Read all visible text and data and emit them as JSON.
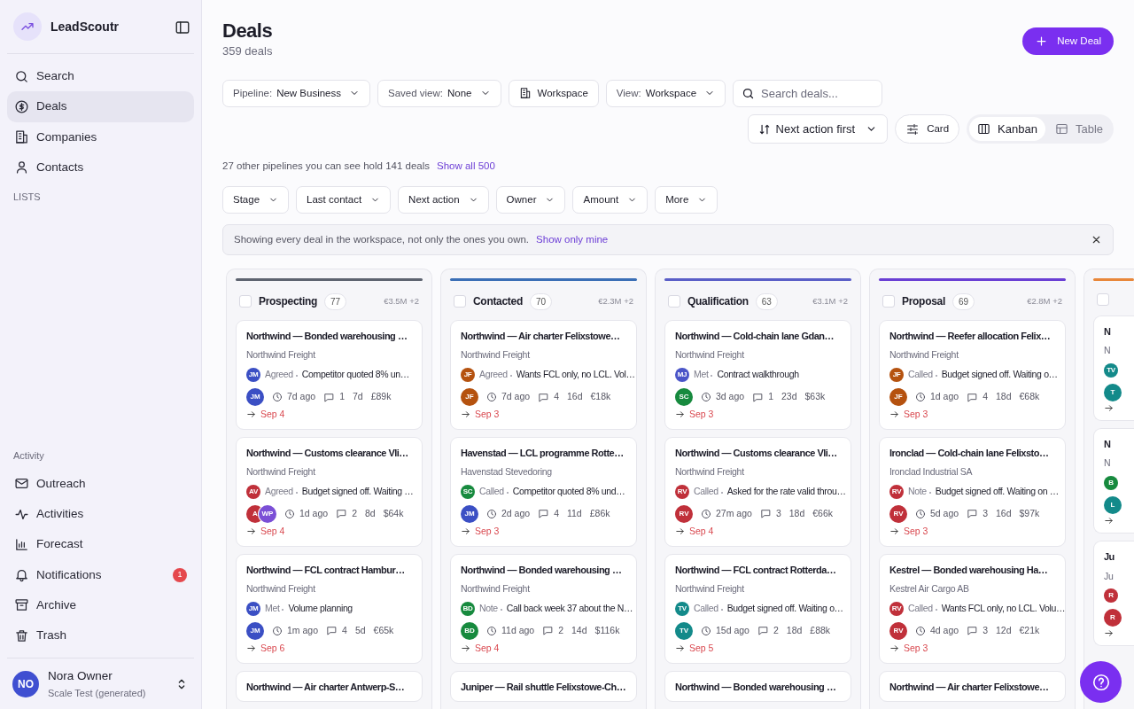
{
  "sidebar": {
    "brand": "LeadScoutr",
    "nav": [
      {
        "label": "Search",
        "selected": false
      },
      {
        "label": "Deals",
        "selected": true
      },
      {
        "label": "Companies",
        "selected": false
      },
      {
        "label": "Contacts",
        "selected": false
      }
    ],
    "lists_heading": "LISTS",
    "activity_heading": "Activity",
    "activity_nav": [
      {
        "label": "Outreach",
        "selected": false
      },
      {
        "label": "Activities",
        "selected": false
      },
      {
        "label": "Forecast",
        "selected": false
      },
      {
        "label": "Notifications",
        "selected": false,
        "badge": "1"
      },
      {
        "label": "Archive",
        "selected": false
      },
      {
        "label": "Trash",
        "selected": false
      }
    ],
    "user": {
      "initials": "NO",
      "color": "#3f4fd1",
      "name": "Nora Owner",
      "workspace": "Scale Test (generated)"
    }
  },
  "header": {
    "title": "Deals",
    "subtitle": "359 deals",
    "new_button": "New Deal"
  },
  "toolbar": {
    "filters": [
      {
        "kind": "dropdown",
        "label": "Pipeline:",
        "value": "New Business"
      },
      {
        "kind": "dropdown",
        "label": "Saved view:",
        "value": "None"
      },
      {
        "kind": "button",
        "value": "Workspace"
      },
      {
        "kind": "dropdown",
        "label": "View:",
        "value": "Workspace"
      }
    ],
    "search": {
      "placeholder": "Search deals..."
    },
    "sort": "Next action first",
    "density": "Card",
    "views": [
      {
        "label": "Kanban",
        "selected": true
      },
      {
        "label": "Table",
        "selected": false
      }
    ]
  },
  "pipelines_note": {
    "text": "27 other pipelines you can see hold 141 deals",
    "link": "Show all 500"
  },
  "chips": [
    "Stage",
    "Last contact",
    "Next action",
    "Owner",
    "Amount",
    "More"
  ],
  "banner": {
    "text": "Showing every deal in the workspace, not only the ones you own.",
    "link": "Show only mine"
  },
  "columns": [
    {
      "name": "Prospecting",
      "count": "77",
      "total": "€3.5M +2",
      "color": "#5e6470",
      "checked": false,
      "cards": [
        {
          "kind": "full",
          "title": "Northwind — Bonded warehousing …",
          "company": "Northwind Freight",
          "activity": {
            "initials": "JM",
            "color": "#3b4fc4",
            "label": "Agreed",
            "note": "Competitor quoted 8% un…"
          },
          "owners": [
            {
              "initials": "JM",
              "color": "#3b4fc4"
            }
          ],
          "last_contact": "7d ago",
          "comments": "1",
          "age": "7d",
          "amount": "£89k",
          "next": "Sep 4"
        },
        {
          "kind": "full",
          "title": "Northwind — Customs clearance Vli…",
          "company": "Northwind Freight",
          "activity": {
            "initials": "AV",
            "color": "#c0303a",
            "label": "Agreed",
            "note": "Budget signed off. Waiting …"
          },
          "owners": [
            {
              "initials": "A",
              "color": "#c0303a"
            },
            {
              "initials": "WP",
              "color": "#7b4fd6"
            }
          ],
          "last_contact": "1d ago",
          "comments": "2",
          "age": "8d",
          "amount": "$64k",
          "next": "Sep 4"
        },
        {
          "kind": "full",
          "title": "Northwind — FCL contract Hambur…",
          "company": "Northwind Freight",
          "activity": {
            "initials": "JM",
            "color": "#3b4fc4",
            "label": "Met",
            "note": "Volume planning"
          },
          "owners": [
            {
              "initials": "JM",
              "color": "#3b4fc4"
            }
          ],
          "last_contact": "1m ago",
          "comments": "4",
          "age": "5d",
          "amount": "€65k",
          "next": "Sep 6"
        },
        {
          "kind": "title",
          "title": "Northwind — Air charter Antwerp-S…"
        }
      ]
    },
    {
      "name": "Contacted",
      "count": "70",
      "total": "€2.3M +2",
      "color": "#3b6fb6",
      "checked": false,
      "cards": [
        {
          "kind": "full",
          "title": "Northwind — Air charter Felixstowe…",
          "company": "Northwind Freight",
          "activity": {
            "initials": "JF",
            "color": "#b5520f",
            "label": "Agreed",
            "note": "Wants FCL only, no LCL. Vol…"
          },
          "owners": [
            {
              "initials": "JF",
              "color": "#b5520f"
            }
          ],
          "last_contact": "7d ago",
          "comments": "4",
          "age": "16d",
          "amount": "€18k",
          "next": "Sep 3"
        },
        {
          "kind": "full",
          "title": "Havenstad — LCL programme Rotte…",
          "company": "Havenstad Stevedoring",
          "activity": {
            "initials": "SC",
            "color": "#178a3e",
            "label": "Called",
            "note": "Competitor quoted 8% und…"
          },
          "owners": [
            {
              "initials": "JM",
              "color": "#3b4fc4"
            }
          ],
          "last_contact": "2d ago",
          "comments": "4",
          "age": "11d",
          "amount": "£86k",
          "next": "Sep 3"
        },
        {
          "kind": "full",
          "title": "Northwind — Bonded warehousing …",
          "company": "Northwind Freight",
          "activity": {
            "initials": "BD",
            "color": "#178a3e",
            "label": "Note",
            "note": "Call back week 37 about the N…"
          },
          "owners": [
            {
              "initials": "BD",
              "color": "#178a3e"
            }
          ],
          "last_contact": "11d ago",
          "comments": "2",
          "age": "14d",
          "amount": "$116k",
          "next": "Sep 4"
        },
        {
          "kind": "title",
          "title": "Juniper — Rail shuttle Felixstowe-Ch…"
        }
      ]
    },
    {
      "name": "Qualification",
      "count": "63",
      "total": "€3.1M +2",
      "color": "#5b5fc7",
      "checked": false,
      "cards": [
        {
          "kind": "full",
          "title": "Northwind — Cold-chain lane Gdan…",
          "company": "Northwind Freight",
          "activity": {
            "initials": "MJ",
            "color": "#4a55c8",
            "label": "Met",
            "note": "Contract walkthrough"
          },
          "owners": [
            {
              "initials": "SC",
              "color": "#178a3e"
            }
          ],
          "last_contact": "3d ago",
          "comments": "1",
          "age": "23d",
          "amount": "$63k",
          "next": "Sep 3"
        },
        {
          "kind": "full",
          "title": "Northwind — Customs clearance Vli…",
          "company": "Northwind Freight",
          "activity": {
            "initials": "RV",
            "color": "#c0303a",
            "label": "Called",
            "note": "Asked for the rate valid throu…"
          },
          "owners": [
            {
              "initials": "RV",
              "color": "#c0303a"
            }
          ],
          "last_contact": "27m ago",
          "comments": "3",
          "age": "18d",
          "amount": "€66k",
          "next": "Sep 4"
        },
        {
          "kind": "full",
          "title": "Northwind — FCL contract Rotterda…",
          "company": "Northwind Freight",
          "activity": {
            "initials": "TV",
            "color": "#138a8a",
            "label": "Called",
            "note": "Budget signed off. Waiting o…"
          },
          "owners": [
            {
              "initials": "TV",
              "color": "#138a8a"
            }
          ],
          "last_contact": "15d ago",
          "comments": "2",
          "age": "18d",
          "amount": "£88k",
          "next": "Sep 5"
        },
        {
          "kind": "title",
          "title": "Northwind — Bonded warehousing …"
        }
      ]
    },
    {
      "name": "Proposal",
      "count": "69",
      "total": "€2.8M +2",
      "color": "#6a3fd4",
      "checked": false,
      "cards": [
        {
          "kind": "full",
          "title": "Northwind — Reefer allocation Felix…",
          "company": "Northwind Freight",
          "activity": {
            "initials": "JF",
            "color": "#b5520f",
            "label": "Called",
            "note": "Budget signed off. Waiting o…"
          },
          "owners": [
            {
              "initials": "JF",
              "color": "#b5520f"
            }
          ],
          "last_contact": "1d ago",
          "comments": "4",
          "age": "18d",
          "amount": "€68k",
          "next": "Sep 3"
        },
        {
          "kind": "full",
          "title": "Ironclad — Cold-chain lane Felixsto…",
          "company": "Ironclad Industrial SA",
          "activity": {
            "initials": "RV",
            "color": "#c0303a",
            "label": "Note",
            "note": "Budget signed off. Waiting on …"
          },
          "owners": [
            {
              "initials": "RV",
              "color": "#c0303a"
            }
          ],
          "last_contact": "5d ago",
          "comments": "3",
          "age": "16d",
          "amount": "$97k",
          "next": "Sep 3"
        },
        {
          "kind": "full",
          "title": "Kestrel — Bonded warehousing Ha…",
          "company": "Kestrel Air Cargo AB",
          "activity": {
            "initials": "RV",
            "color": "#c0303a",
            "label": "Called",
            "note": "Wants FCL only, no LCL. Volu…"
          },
          "owners": [
            {
              "initials": "RV",
              "color": "#c0303a"
            }
          ],
          "last_contact": "4d ago",
          "comments": "3",
          "age": "12d",
          "amount": "€21k",
          "next": "Sep 3"
        },
        {
          "kind": "title",
          "title": "Northwind — Air charter Felixstowe…"
        }
      ]
    },
    {
      "color": "#e8873a",
      "checked": false,
      "cards": [
        {
          "kind": "clipped",
          "title": "N",
          "company": "N",
          "activity": {
            "initials": "TV",
            "color": "#138a8a"
          },
          "owners": [
            {
              "initials": "T",
              "color": "#138a8a"
            }
          ]
        },
        {
          "kind": "clipped",
          "title": "N",
          "company": "N",
          "activity": {
            "initials": "B",
            "color": "#178a3e"
          },
          "owners": [
            {
              "initials": "L",
              "color": "#138a8a"
            }
          ]
        },
        {
          "kind": "clipped",
          "title": "Ju",
          "company": "Ju",
          "activity": {
            "initials": "R",
            "color": "#c0303a"
          },
          "owners": [
            {
              "initials": "R",
              "color": "#c0303a"
            }
          ]
        }
      ]
    }
  ]
}
